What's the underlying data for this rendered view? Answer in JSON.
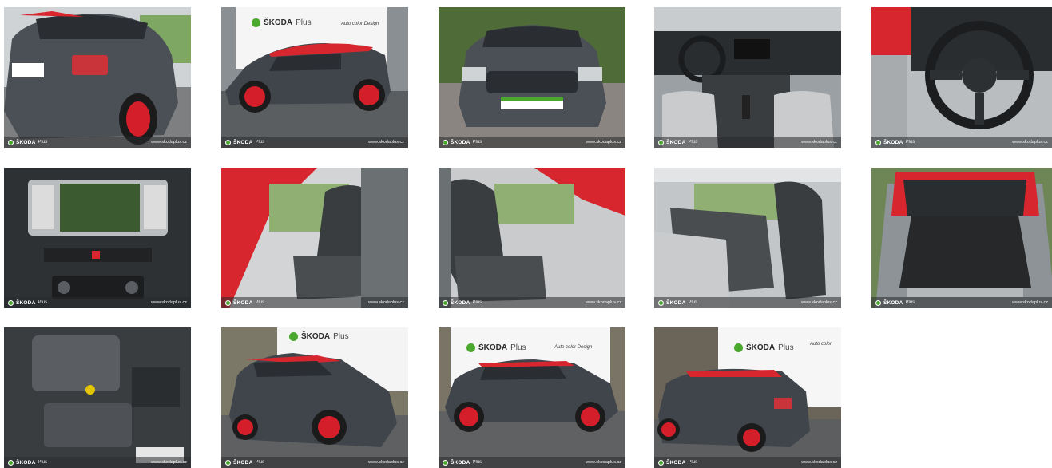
{
  "gallery": {
    "watermark": {
      "brand": "ŠKODA",
      "sub": "Plus",
      "url": "www.skodaplus.cz"
    },
    "banner": {
      "brand": "ŠKODA",
      "sub": "Plus",
      "tagline": "Auto color Design",
      "tagline_short": "Auto color"
    },
    "photos": [
      {
        "view": "rear three-quarter exterior"
      },
      {
        "view": "side profile exterior with banner"
      },
      {
        "view": "front exterior"
      },
      {
        "view": "dashboard interior"
      },
      {
        "view": "steering wheel"
      },
      {
        "view": "infotainment display"
      },
      {
        "view": "front seats from driver door"
      },
      {
        "view": "front seats from passenger door"
      },
      {
        "view": "rear seats"
      },
      {
        "view": "trunk"
      },
      {
        "view": "engine bay"
      },
      {
        "view": "front three-quarter exterior"
      },
      {
        "view": "side profile exterior"
      },
      {
        "view": "rear three-quarter exterior with banner"
      }
    ],
    "colors": {
      "body": "#4a5056",
      "roof": "#d8262e",
      "wheels": "#d41e2a",
      "brand_green": "#4ba82e"
    }
  }
}
